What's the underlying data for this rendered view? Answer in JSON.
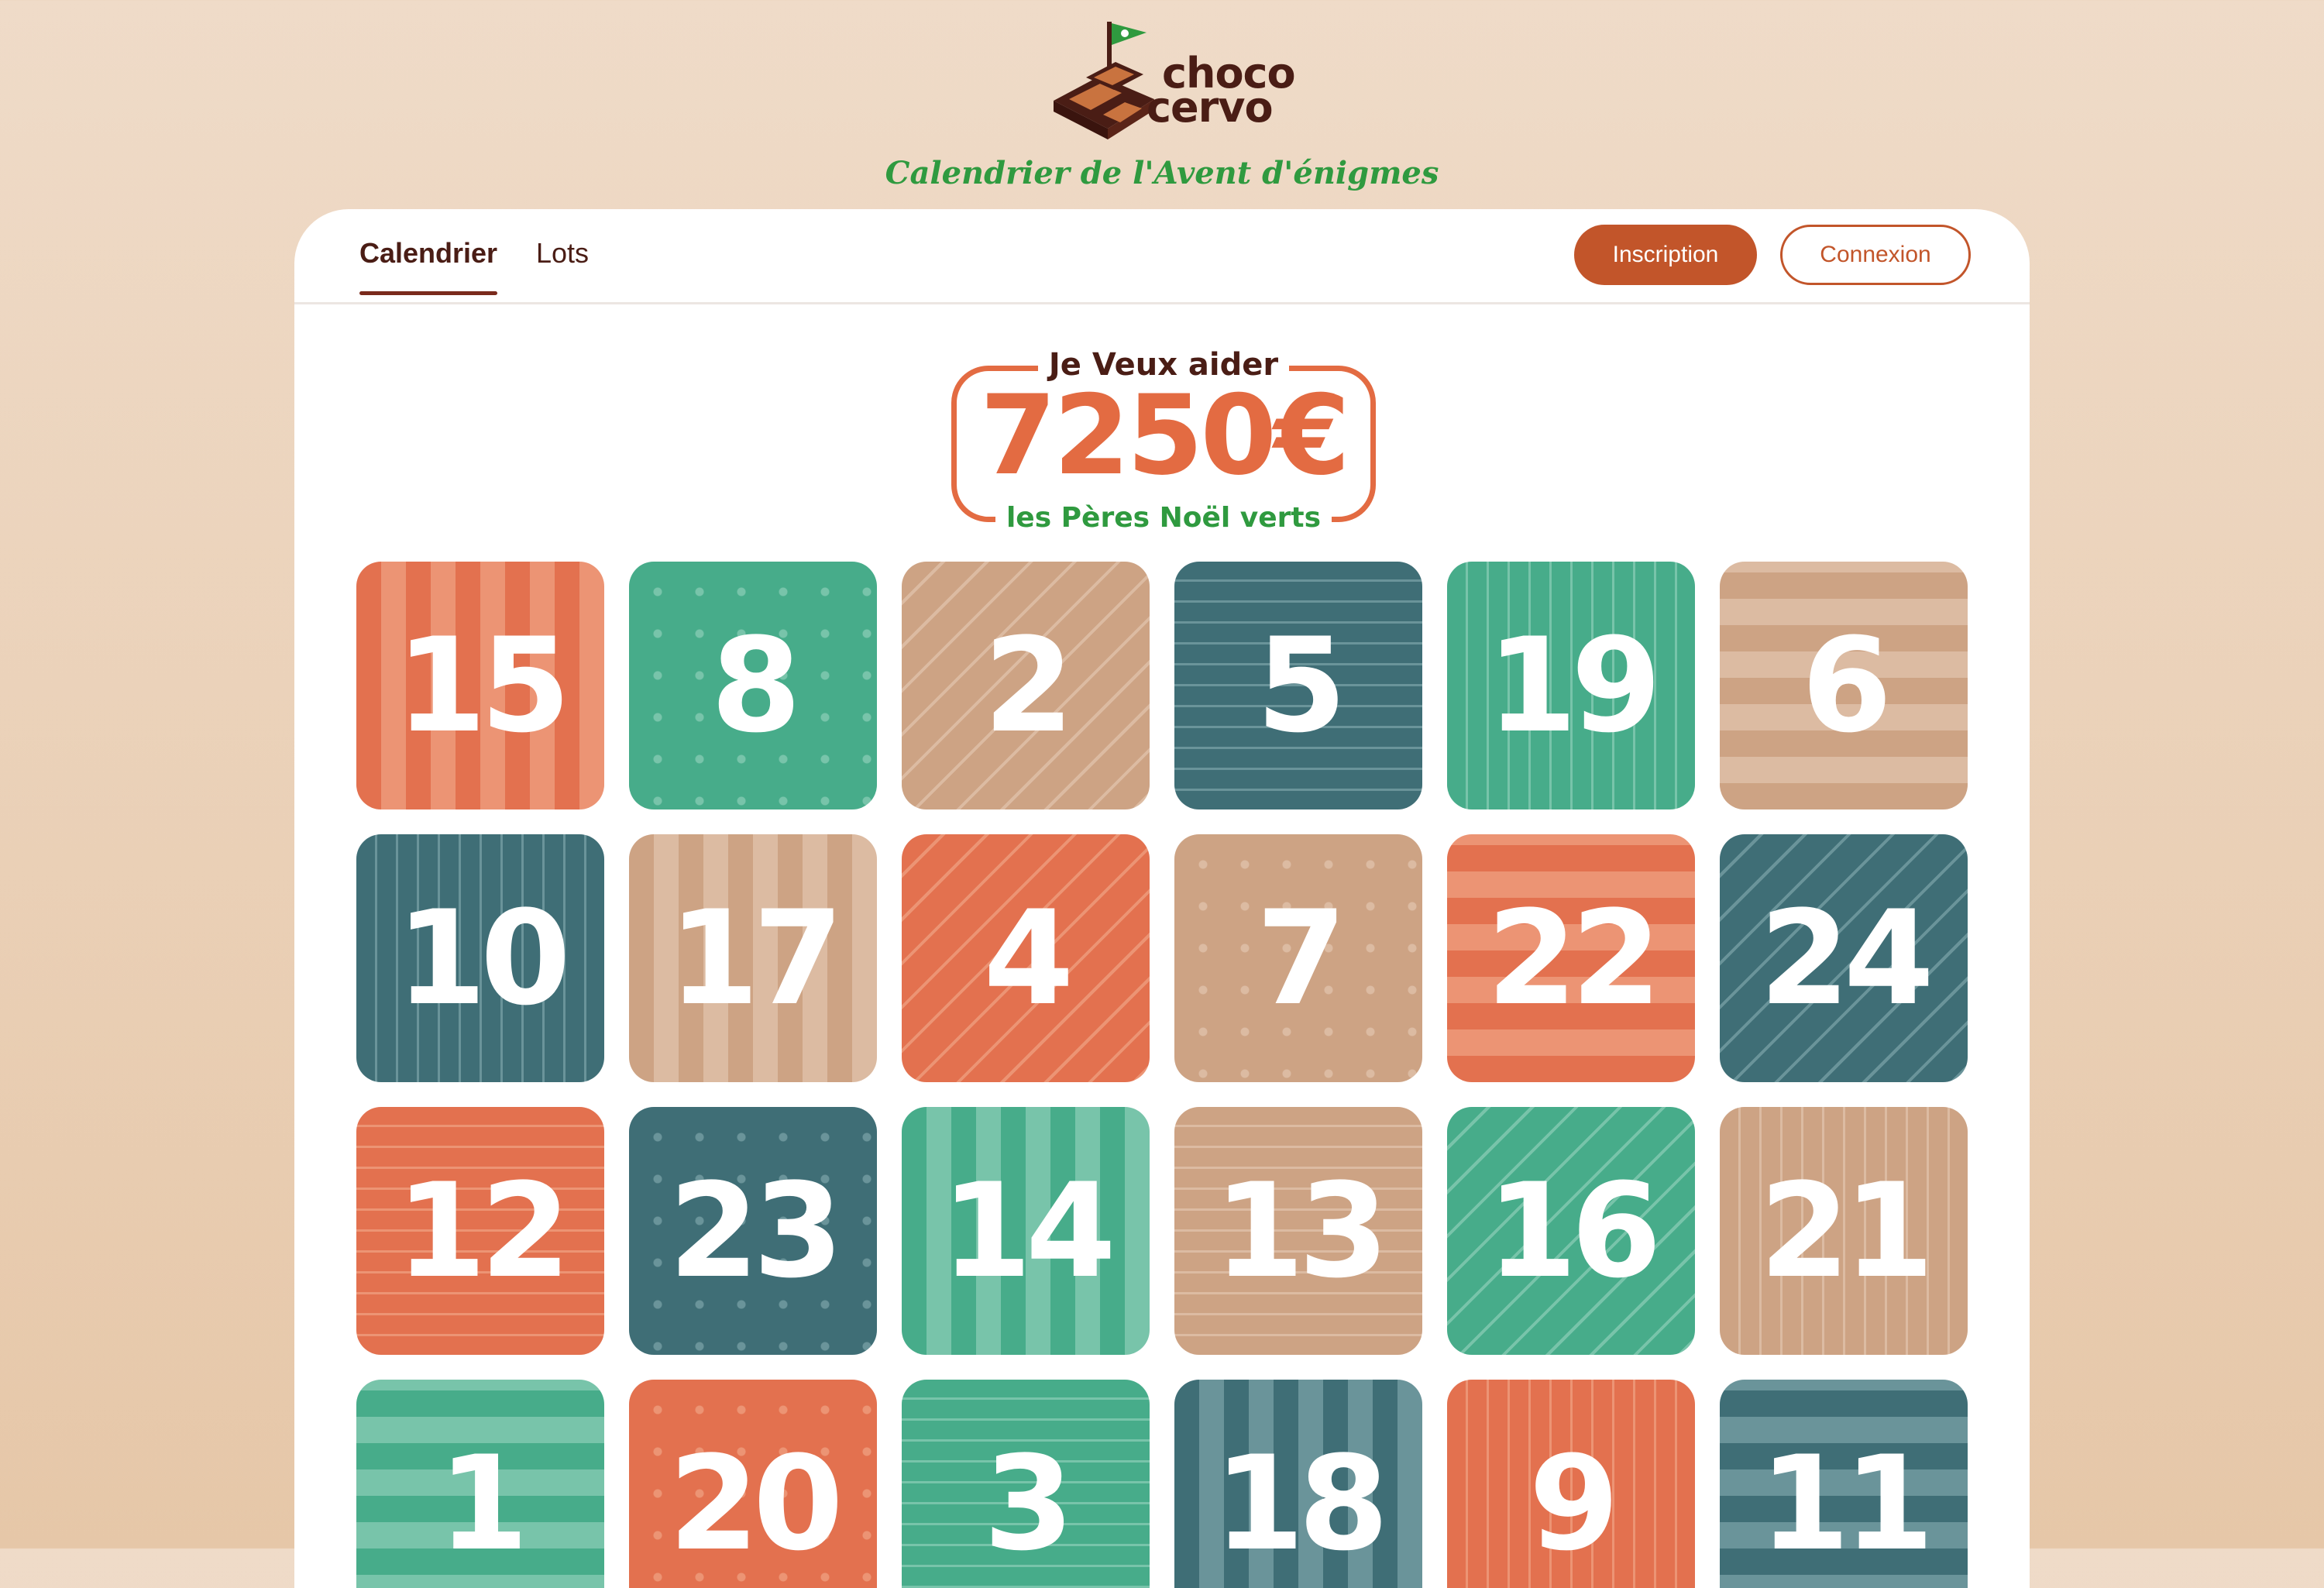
{
  "brand": {
    "line1": "choco",
    "line2": "cervo",
    "tagline": "Calendrier de l'Avent d'énigmes"
  },
  "nav": {
    "tabs": [
      {
        "label": "Calendrier",
        "active": true
      },
      {
        "label": "Lots",
        "active": false
      }
    ],
    "signup_label": "Inscription",
    "login_label": "Connexion"
  },
  "donation": {
    "top": "Je Veux aider",
    "amount": "7250€",
    "bottom": "les Pères Noël verts"
  },
  "colors": {
    "accent": "#c2552a",
    "brand_green": "#2f9a3f",
    "coral": "#e3714f",
    "green": "#47ac8a",
    "tan": "#cda384",
    "teal": "#3f6e76"
  },
  "doors": [
    {
      "number": "15",
      "color": "coral",
      "pattern": "vstripe"
    },
    {
      "number": "8",
      "color": "green",
      "pattern": "dots"
    },
    {
      "number": "2",
      "color": "tan",
      "pattern": "diag"
    },
    {
      "number": "5",
      "color": "teal",
      "pattern": "hlines"
    },
    {
      "number": "19",
      "color": "green",
      "pattern": "vlines"
    },
    {
      "number": "6",
      "color": "tan",
      "pattern": "hstripe"
    },
    {
      "number": "10",
      "color": "teal",
      "pattern": "vlines"
    },
    {
      "number": "17",
      "color": "tan",
      "pattern": "vstripe"
    },
    {
      "number": "4",
      "color": "coral",
      "pattern": "diag"
    },
    {
      "number": "7",
      "color": "tan",
      "pattern": "dots"
    },
    {
      "number": "22",
      "color": "coral",
      "pattern": "hstripe"
    },
    {
      "number": "24",
      "color": "teal",
      "pattern": "diag"
    },
    {
      "number": "12",
      "color": "coral",
      "pattern": "hlines"
    },
    {
      "number": "23",
      "color": "teal",
      "pattern": "dots"
    },
    {
      "number": "14",
      "color": "green",
      "pattern": "vstripe"
    },
    {
      "number": "13",
      "color": "tan",
      "pattern": "hlines"
    },
    {
      "number": "16",
      "color": "green",
      "pattern": "diag"
    },
    {
      "number": "21",
      "color": "tan",
      "pattern": "vlines"
    },
    {
      "number": "1",
      "color": "green",
      "pattern": "hstripe"
    },
    {
      "number": "20",
      "color": "coral",
      "pattern": "dots"
    },
    {
      "number": "3",
      "color": "green",
      "pattern": "hlines"
    },
    {
      "number": "18",
      "color": "teal",
      "pattern": "vstripe"
    },
    {
      "number": "9",
      "color": "coral",
      "pattern": "vlines"
    },
    {
      "number": "11",
      "color": "teal",
      "pattern": "hstripe"
    }
  ]
}
